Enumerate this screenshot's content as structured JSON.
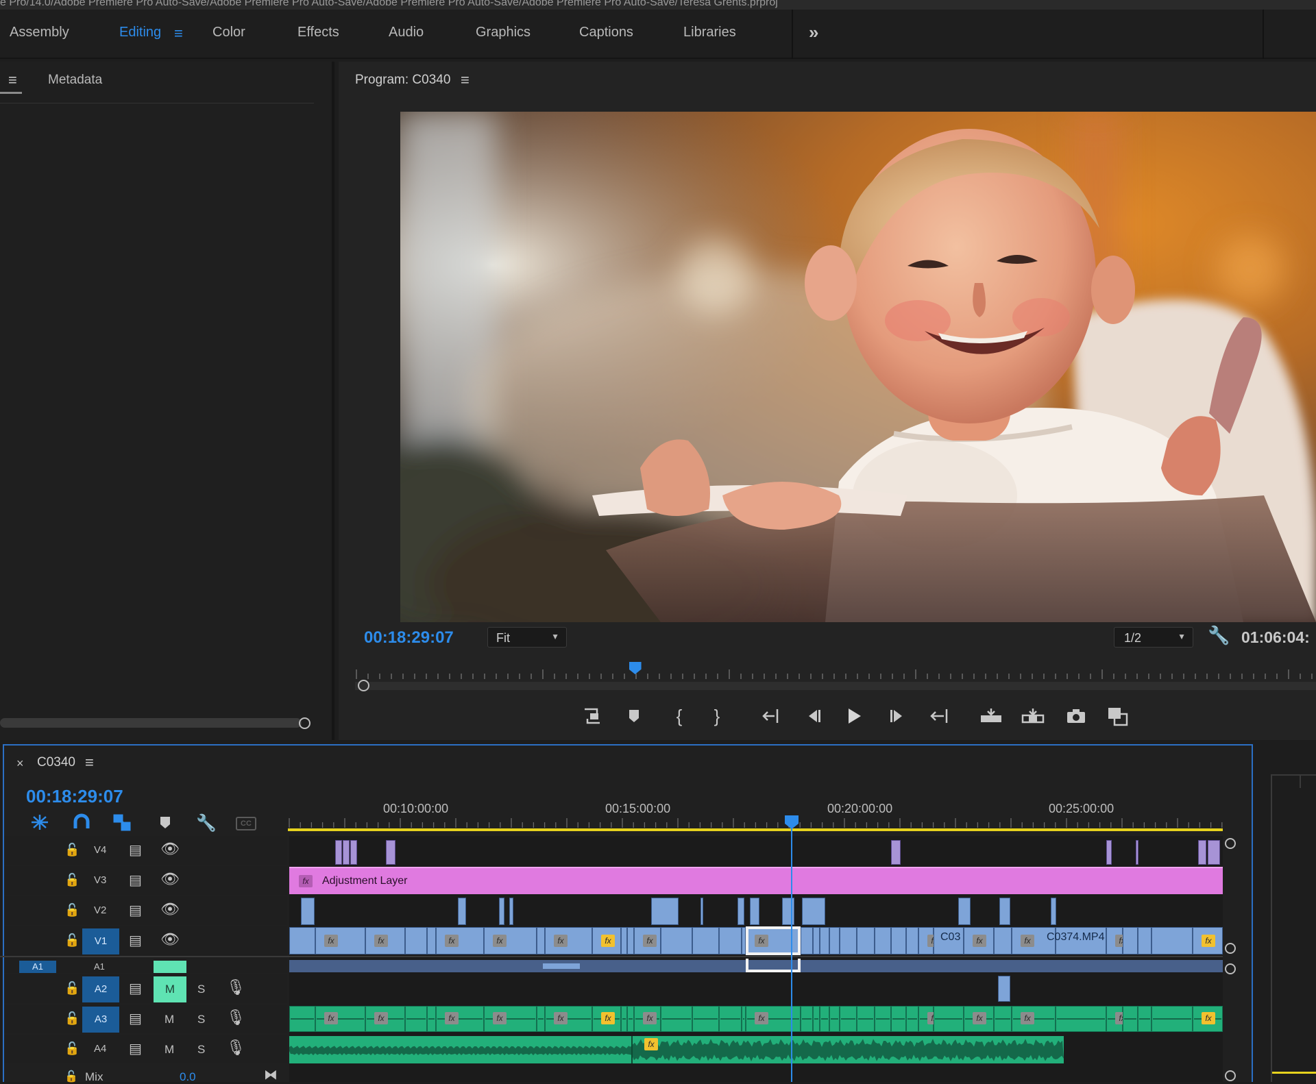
{
  "titlebar": {
    "text": "e Pro/14.0/Adobe Premiere Pro Auto-Save/Adobe Premiere Pro Auto-Save/Adobe Premiere Pro Auto-Save/Adobe Premiere Pro Auto-Save/Teresa Grents.prproj"
  },
  "workspaces": {
    "tabs": [
      "Assembly",
      "Editing",
      "Color",
      "Effects",
      "Audio",
      "Graphics",
      "Captions",
      "Libraries"
    ],
    "active": "Editing",
    "more_icon": "double-chevron-right-icon"
  },
  "left_panel": {
    "tab": "Metadata",
    "menu_icon": "hamburger-icon"
  },
  "program_monitor": {
    "title": "Program: C0340",
    "timecode": "00:18:29:07",
    "zoom": "Fit",
    "resolution": "1/2",
    "duration": "01:06:04:",
    "playhead_fraction": 0.29,
    "image_alt": "smiling toddler holding a spoon",
    "transport_icons": [
      "lift-icon",
      "marker-icon",
      "mark-in-icon",
      "mark-out-icon",
      "go-to-in-icon",
      "step-back-icon",
      "play-icon",
      "step-forward-icon",
      "go-to-out-icon",
      "insert-icon",
      "overwrite-icon",
      "export-frame-icon",
      "comparison-view-icon"
    ]
  },
  "timeline": {
    "sequence_name": "C0340",
    "timecode": "00:18:29:07",
    "ruler": [
      "00:10:00:00",
      "00:15:00:00",
      "00:20:00:00",
      "00:25:00:00"
    ],
    "tracks": {
      "video": [
        "V4",
        "V3",
        "V2",
        "V1"
      ],
      "audio": [
        "A1",
        "A2",
        "A3",
        "A4"
      ],
      "source_v": "V1",
      "source_a": "A1",
      "mix_label": "Mix",
      "mix_value": "0.0"
    },
    "clip_labels": {
      "adjustment": "Adjustment Layer",
      "c03": "C03",
      "c0374": "C0374.MP4"
    },
    "toggles": {
      "m": "M",
      "s": "S",
      "cc": "CC"
    },
    "colors": {
      "accent": "#2d8ceb",
      "video": "#7ea4d8",
      "audio": "#22b07a",
      "adjustment": "#e07ae0",
      "work_area": "#e6d21e"
    }
  }
}
